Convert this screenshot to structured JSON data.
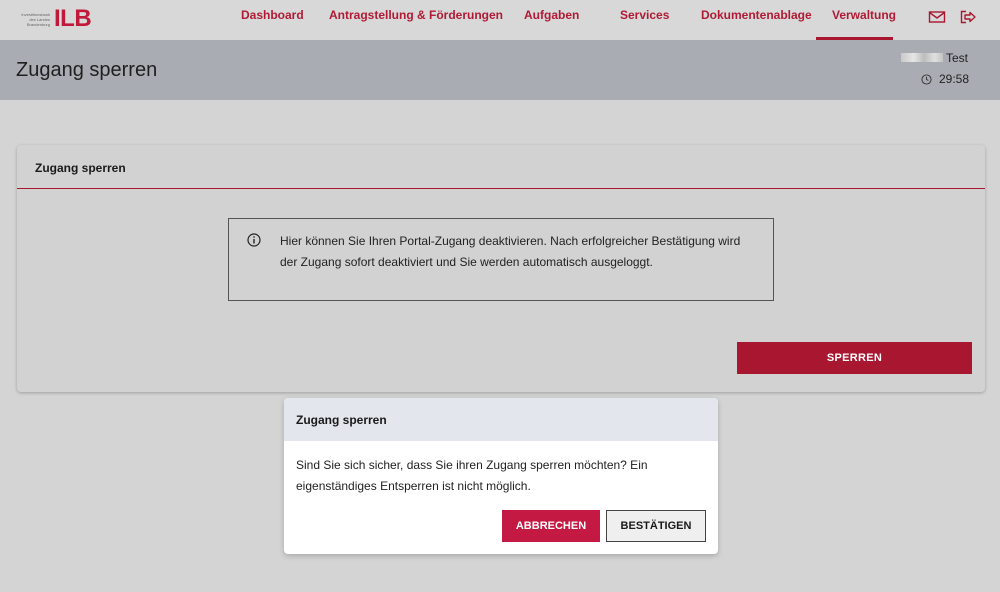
{
  "logo": {
    "small_lines": [
      "Investitionsbank",
      "des Landes",
      "Brandenburg"
    ],
    "big": "ILB"
  },
  "nav": {
    "items": [
      {
        "label": "Dashboard"
      },
      {
        "label": "Antragstellung & Förderungen"
      },
      {
        "label": "Aufgaben"
      },
      {
        "label": "Services"
      },
      {
        "label": "Dokumentenablage"
      },
      {
        "label": "Verwaltung",
        "active": true
      }
    ],
    "icons": [
      "mail-icon",
      "logout-icon"
    ]
  },
  "header": {
    "title": "Zugang sperren",
    "user_name": "Test",
    "timer": "29:58"
  },
  "card": {
    "title": "Zugang sperren",
    "info_text": "Hier können Sie Ihren Portal-Zugang deaktivieren. Nach erfolgreicher Bestätigung wird der Zugang sofort deaktiviert und Sie werden automatisch ausgeloggt.",
    "button_label": "SPERREN"
  },
  "dialog": {
    "title": "Zugang sperren",
    "message": "Sind Sie sich sicher, dass Sie ihren Zugang sperren möchten? Ein eigenständiges Entsperren ist nicht möglich.",
    "cancel_label": "ABBRECHEN",
    "confirm_label": "BESTÄTIGEN"
  },
  "colors": {
    "brand": "#a8162f",
    "cancel": "#c31942",
    "page_bg": "#d4d4d4",
    "header_bg": "#a9acb2"
  }
}
